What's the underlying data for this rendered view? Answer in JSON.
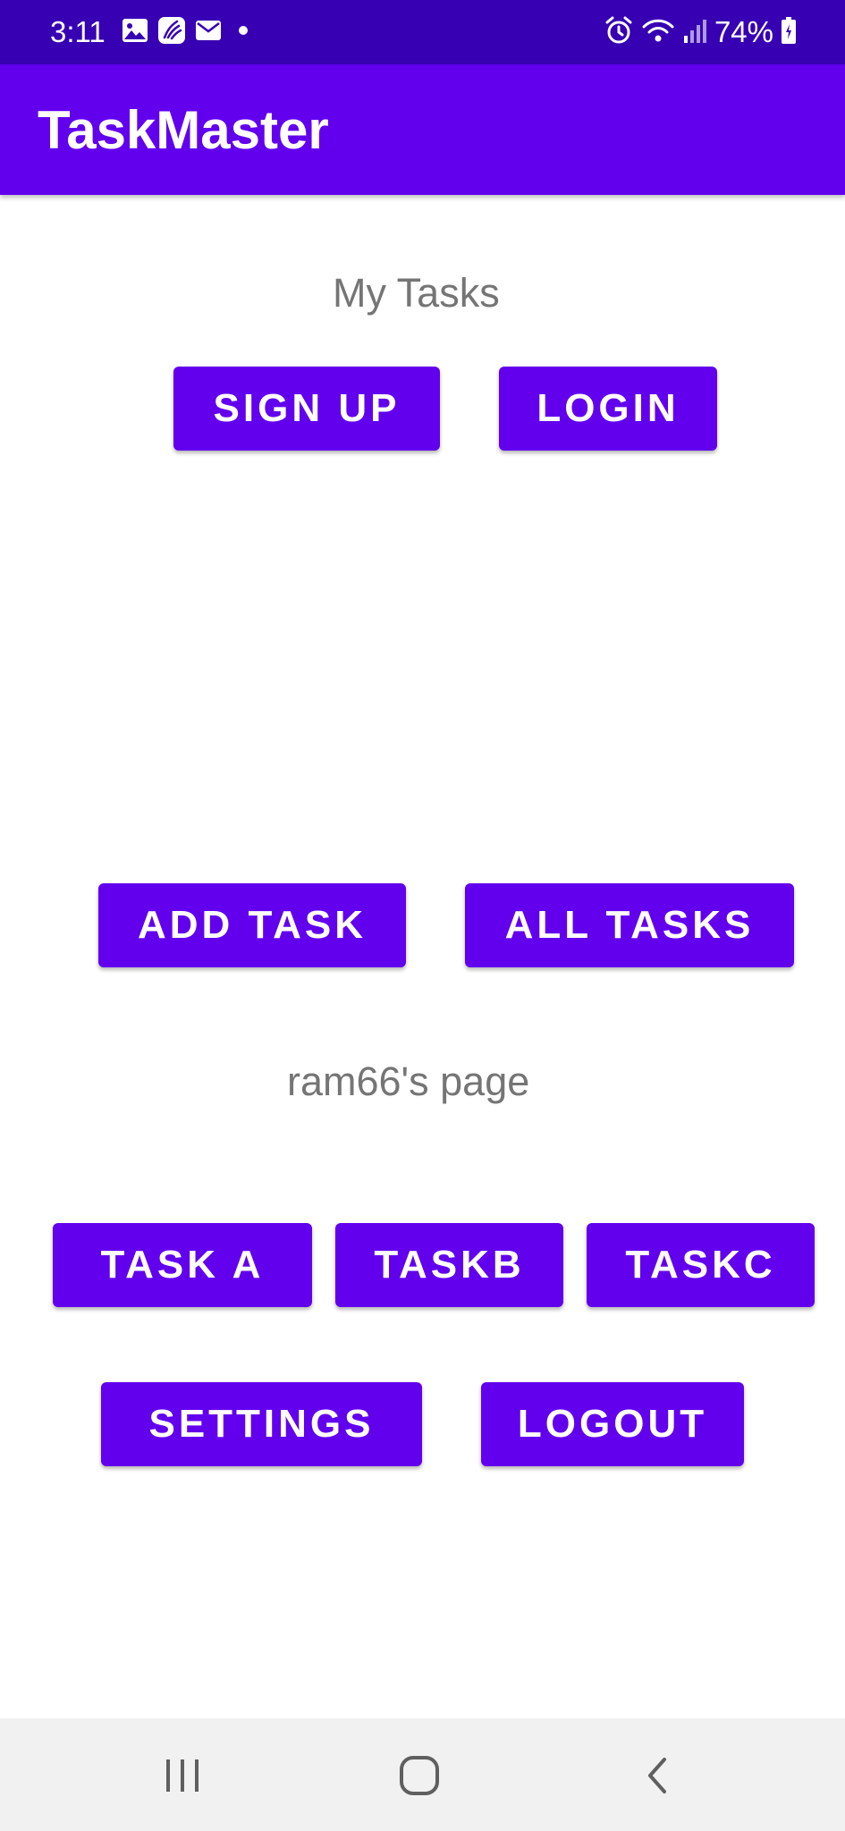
{
  "status_bar": {
    "time": "3:11",
    "battery": "74%",
    "left_icons": [
      "gallery-icon",
      "app-notification-icon",
      "mail-icon",
      "dot-icon"
    ],
    "right_icons": [
      "alarm-icon",
      "wifi-icon",
      "signal-icon",
      "battery-icon"
    ]
  },
  "app_bar": {
    "title": "TaskMaster"
  },
  "main": {
    "heading": "My Tasks",
    "sign_up_label": "SIGN UP",
    "login_label": "LOGIN",
    "add_task_label": "ADD TASK",
    "all_tasks_label": "ALL TASKS",
    "user_page_label": "ram66's page",
    "task_a_label": "TASK A",
    "task_b_label": "TASKB",
    "task_c_label": "TASKC",
    "settings_label": "SETTINGS",
    "logout_label": "LOGOUT"
  },
  "nav_bar": {
    "icons": [
      "recents-icon",
      "home-icon",
      "back-icon"
    ]
  },
  "colors": {
    "status_bar": "#3700b3",
    "primary": "#6200ee",
    "secondary_text": "#757575",
    "nav_bar": "#f1f1f1"
  }
}
